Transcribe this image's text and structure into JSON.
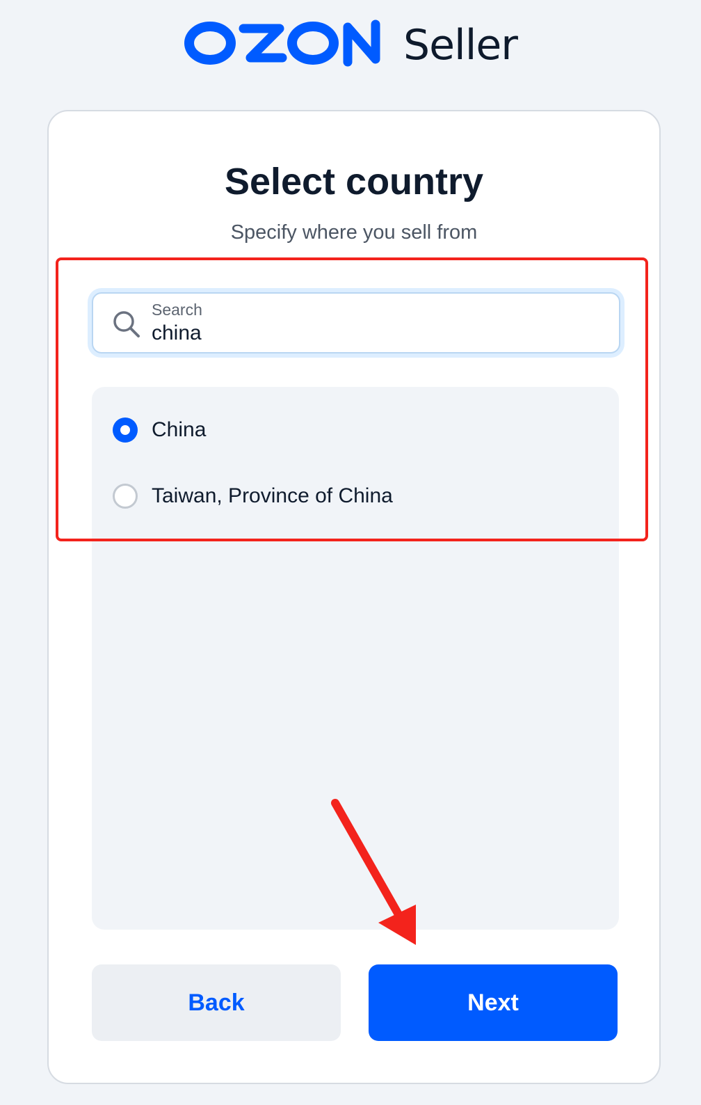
{
  "header": {
    "logo_text": "OZON",
    "seller_label": "Seller"
  },
  "card": {
    "title": "Select country",
    "subtitle": "Specify where you sell from"
  },
  "search": {
    "label": "Search",
    "value": "china",
    "icon": "search-icon"
  },
  "countries": [
    {
      "label": "China",
      "selected": true
    },
    {
      "label": "Taiwan, Province of China",
      "selected": false
    }
  ],
  "buttons": {
    "back_label": "Back",
    "next_label": "Next"
  },
  "colors": {
    "brand_blue": "#005bff",
    "page_background": "#f1f4f8",
    "annotation_red": "#f3231c"
  },
  "annotations": {
    "highlight": "red-rectangle",
    "pointer": "red-arrow"
  }
}
